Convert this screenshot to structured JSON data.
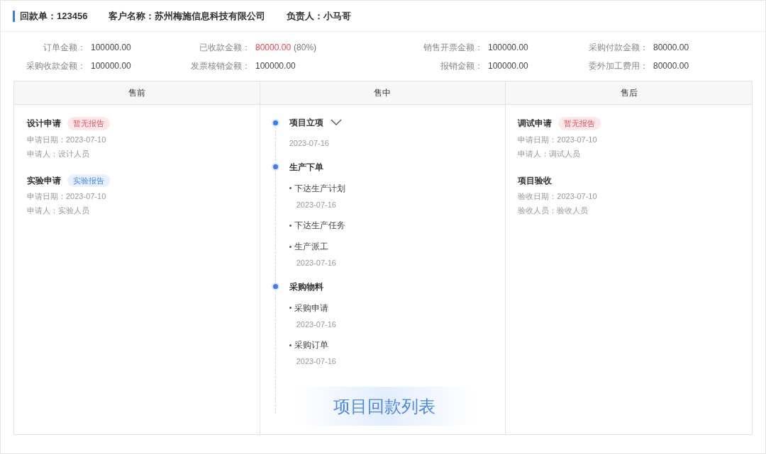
{
  "header": [
    {
      "label": "回款单：",
      "value": "123456"
    },
    {
      "label": "客户名称：",
      "value": "苏州梅施信息科技有限公司"
    },
    {
      "label": "负责人：",
      "value": "小马哥"
    }
  ],
  "summary": [
    {
      "label": "订单金额：",
      "value": "100000.00",
      "highlight": false
    },
    {
      "label": "已收款金额：",
      "value": "80000.00",
      "highlight": true,
      "note": "(80%)"
    },
    {
      "label": "销售开票金额：",
      "value": "100000.00",
      "highlight": false
    },
    {
      "label": "采购付款金额：",
      "value": "80000.00",
      "highlight": false
    },
    {
      "label": "采购收款金额：",
      "value": "100000.00",
      "highlight": false
    },
    {
      "label": "发票核销金额：",
      "value": "100000.00",
      "highlight": false
    },
    {
      "label": "报销金额：",
      "value": "100000.00",
      "highlight": false
    },
    {
      "label": "委外加工费用：",
      "value": "80000.00",
      "highlight": false
    }
  ],
  "columns": [
    "售前",
    "售中",
    "售后"
  ],
  "presale": [
    {
      "title": "设计申请",
      "tag": {
        "text": "暂无报告",
        "kind": "missing"
      },
      "lines": [
        "申请日期：2023-07-10",
        "申请人：设计人员"
      ]
    },
    {
      "title": "实验申请",
      "tag": {
        "text": "实验报告",
        "kind": "report"
      },
      "lines": [
        "申请日期：2023-07-10",
        "申请人：实验人员"
      ]
    }
  ],
  "timeline": [
    {
      "title": "项目立项",
      "expandable": true,
      "date": "2023-07-16"
    },
    {
      "title": "生产下单",
      "expandable": false,
      "children": [
        {
          "title": "下达生产计划",
          "date": "2023-07-16"
        },
        {
          "title": "下达生产任务"
        },
        {
          "title": "生产派工",
          "date": "2023-07-16"
        }
      ]
    },
    {
      "title": "采购物料",
      "expandable": false,
      "children": [
        {
          "title": "采购申请",
          "date": "2023-07-16"
        },
        {
          "title": "采购订单",
          "date": "2023-07-16"
        }
      ]
    }
  ],
  "aftersale": [
    {
      "title": "调试申请",
      "tag": {
        "text": "暂无报告",
        "kind": "missing"
      },
      "lines": [
        "申请日期：2023-07-10",
        "申请人：调试人员"
      ]
    },
    {
      "title": "项目验收",
      "lines": [
        "验收日期：2023-07-10",
        "验收人员：验收人员"
      ]
    }
  ],
  "banner": "项目回款列表"
}
